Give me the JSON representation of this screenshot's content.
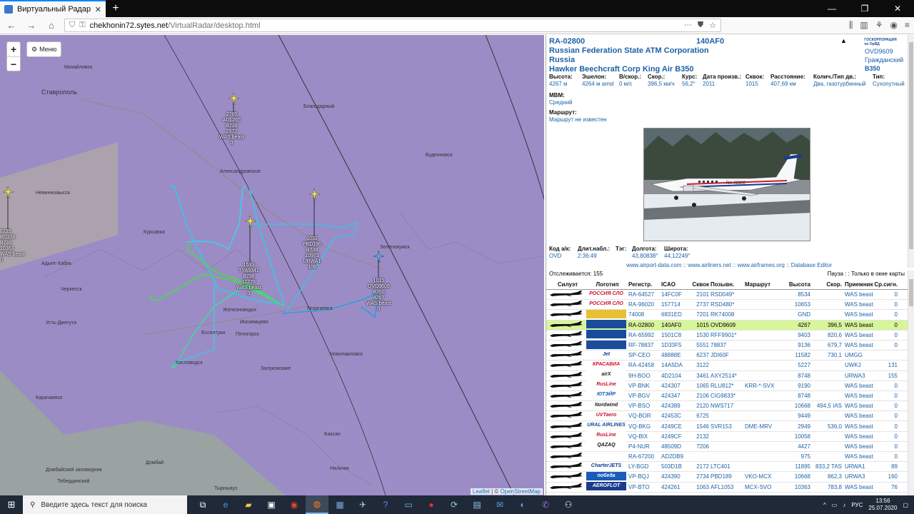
{
  "browser": {
    "tab_title": "Виртуальный Радар (155)",
    "tab_close": "✕",
    "new_tab": "+",
    "url_host": "chekhonin72.sytes.net",
    "url_path": "/VirtualRadar/desktop.html"
  },
  "map": {
    "zoom_in": "+",
    "zoom_out": "−",
    "menu_label": "Меню",
    "attribution_leaflet": "Leaflet",
    "attribution_sep": " | © ",
    "attribution_osm": "OpenStreetMap",
    "cities": [
      {
        "name": "Михайловск"
      },
      {
        "name": "Ставрополь"
      },
      {
        "name": "Благодарный"
      },
      {
        "name": "Буденновск"
      },
      {
        "name": "Александровское"
      },
      {
        "name": "Невинномысск"
      },
      {
        "name": "Курсавка"
      },
      {
        "name": "Зеленокумск"
      },
      {
        "name": "Адыге-Хабль"
      },
      {
        "name": "Черкесск"
      },
      {
        "name": "Усть-Джегута"
      },
      {
        "name": "Ессентуки"
      },
      {
        "name": "Пятигорск"
      },
      {
        "name": "Железноводск"
      },
      {
        "name": "Иноземцево"
      },
      {
        "name": "Георгиевск"
      },
      {
        "name": "Кисловодск"
      },
      {
        "name": "Новопавловск"
      },
      {
        "name": "Залукокоаже"
      },
      {
        "name": "Карачаевск"
      },
      {
        "name": "Домбай"
      },
      {
        "name": "Баксан"
      },
      {
        "name": "Нальчик"
      },
      {
        "name": "Тырныауз"
      },
      {
        "name": "Домбайский заповедник"
      },
      {
        "name": "Тебердинский"
      }
    ],
    "aircraft": [
      {
        "lines": [
          "2765",
          "AUL265",
          "B738",
          "2972",
          "WAS beast",
          "0"
        ]
      },
      {
        "lines": [
          "6735",
          "BD338",
          "B738",
          "10363",
          "WAS beast",
          "0"
        ]
      },
      {
        "lines": [
          "1032",
          "PBD196",
          "B738",
          "10973",
          "URWA1",
          "106"
        ]
      },
      {
        "lines": [
          "1533",
          "TYA9341",
          "B738",
          "11278",
          "WAS beast",
          "0"
        ]
      },
      {
        "lines": [
          "1015",
          "OVD9609",
          "B350",
          "4267",
          "WAS beast",
          "0"
        ]
      }
    ]
  },
  "detail": {
    "registration": "RA-02800",
    "icao": "140AF0",
    "operator": "Russian Federation State ATM Corporation",
    "country": "Russia",
    "model": "Hawker Beechcraft Corp King Air B350",
    "callsign": "OVD9609",
    "type_civil": "Гражданский",
    "type_code": "B350",
    "logo_text": "ГОСКОРПОРАЦИЯ по ОрВД",
    "stats": [
      {
        "label": "Высота:",
        "value": "4267 м"
      },
      {
        "label": "Эшелон:",
        "value": "4264 м amsl"
      },
      {
        "label": "В/скор.:",
        "value": "0 м/с"
      },
      {
        "label": "Скор.:",
        "value": "396,5 км/ч"
      },
      {
        "label": "Курс:",
        "value": "56,2°"
      },
      {
        "label": "Дата произв.:",
        "value": "2011"
      },
      {
        "label": "Сквок:",
        "value": "1015"
      },
      {
        "label": "Расстояние:",
        "value": "407,69 км"
      },
      {
        "label": "Колич./Тип дв.:",
        "value": "Два, газотурбинный"
      },
      {
        "label": "Тип:",
        "value": "Сухопутный"
      }
    ],
    "mvm_label": "MBM:",
    "mvm_value": "Средний",
    "route_label": "Маршрут:",
    "route_value": "Маршрут не известен",
    "photo_reg": "RA-02800",
    "bottom_stats": [
      {
        "label": "Код а/к:",
        "value": "OVD"
      },
      {
        "label": "Длит.набл.:",
        "value": "2:36:49"
      },
      {
        "label": "Тэг:",
        "value": ""
      },
      {
        "label": "Долгота:",
        "value": "43,80838°"
      },
      {
        "label": "Широта:",
        "value": "44,12249°"
      }
    ],
    "links": "www.airport-data.com :: www.airliners.net :: www.airframes.org :: Database Editor"
  },
  "list": {
    "tracked": "Отслеживается: 155",
    "status": "Пауза : : Только в окне карты",
    "headers": {
      "silhouette": "Силуэт",
      "logo": "Логотип",
      "reg": "Регистр.",
      "icao": "ICAO",
      "squawk": "Сквок",
      "callsign": "Позывн.",
      "route": "Маршрут",
      "altitude": "Высота",
      "speed": "Скор.",
      "receiver": "Приемник",
      "signal": "Ср.сигн."
    },
    "rows": [
      {
        "logo": "РОССИЯ СЛО",
        "logo_color": "#c8102e",
        "reg": "RA-64527",
        "icao": "14FC0F",
        "squawk": "2101",
        "callsign": "RSD049*",
        "route": "",
        "alt": "8534",
        "spd": "",
        "recv": "WAS beast",
        "sig": "0",
        "sel": false
      },
      {
        "logo": "РОССИЯ СЛО",
        "logo_color": "#c8102e",
        "reg": "RA-96020",
        "icao": "157714",
        "squawk": "2737",
        "callsign": "RSD480*",
        "route": "",
        "alt": "10653",
        "spd": "",
        "recv": "WAS beast",
        "sig": "0",
        "sel": false
      },
      {
        "logo": "",
        "logo_color": "#e8c030",
        "reg": "74008",
        "icao": "6831ED",
        "squawk": "7201",
        "callsign": "RK74008",
        "route": "",
        "alt": "GND",
        "spd": "",
        "recv": "WAS beast",
        "sig": "0",
        "sel": false
      },
      {
        "logo": "",
        "logo_color": "#1a4c9c",
        "reg": "RA-02800",
        "icao": "140AF0",
        "squawk": "1015",
        "callsign": "OVD9609",
        "route": "",
        "alt": "4267",
        "spd": "396,5",
        "recv": "WAS beast",
        "sig": "0",
        "sel": true
      },
      {
        "logo": "",
        "logo_color": "#1a4c9c",
        "reg": "RA-65992",
        "icao": "1501C8",
        "squawk": "1530",
        "callsign": "RFF9901*",
        "route": "",
        "alt": "9403",
        "spd": "820,6",
        "recv": "WAS beast",
        "sig": "0",
        "sel": false
      },
      {
        "logo": "",
        "logo_color": "#1a4c9c",
        "reg": "RF-78837",
        "icao": "1D33F5",
        "squawk": "5551",
        "callsign": "78837",
        "route": "",
        "alt": "9136",
        "spd": "679,7",
        "recv": "WAS beast",
        "sig": "0",
        "sel": false
      },
      {
        "logo": "Jet",
        "logo_color": "#0a3c8c",
        "reg": "SP-CEO",
        "icao": "48888E",
        "squawk": "6237",
        "callsign": "JDI60F",
        "route": "",
        "alt": "11582",
        "spd": "730,1",
        "recv": "UMGG",
        "sig": "",
        "sel": false
      },
      {
        "logo": "КРАСАВИА",
        "logo_color": "#d4102a",
        "reg": "RA-42458",
        "icao": "14A5DA",
        "squawk": "3122",
        "callsign": "",
        "route": "",
        "alt": "5227",
        "spd": "",
        "recv": "UWKJ",
        "sig": "131",
        "sel": false
      },
      {
        "logo": "airX",
        "logo_color": "#222",
        "reg": "9H-BOO",
        "icao": "4D2104",
        "squawk": "3461",
        "callsign": "AXY2514*",
        "route": "",
        "alt": "8748",
        "spd": "",
        "recv": "URWA3",
        "sig": "155",
        "sel": false
      },
      {
        "logo": "RusLine",
        "logo_color": "#d4102a",
        "reg": "VP-BNK",
        "icao": "424307",
        "squawk": "1065",
        "callsign": "RLU812*",
        "route": "KRR-*-SVX",
        "alt": "9190",
        "spd": "",
        "recv": "WAS beast",
        "sig": "0",
        "sel": false
      },
      {
        "logo": "ЮТЭЙР",
        "logo_color": "#1a5cb8",
        "reg": "VP-BGV",
        "icao": "424347",
        "squawk": "2106",
        "callsign": "CIG9833*",
        "route": "",
        "alt": "8748",
        "spd": "",
        "recv": "WAS beast",
        "sig": "0",
        "sel": false
      },
      {
        "logo": "Nordwind",
        "logo_color": "#222",
        "reg": "VP-BSO",
        "icao": "424389",
        "squawk": "2120",
        "callsign": "NWS717",
        "route": "",
        "alt": "10668",
        "spd": "494,5 IAS",
        "recv": "WAS beast",
        "sig": "0",
        "sel": false
      },
      {
        "logo": "UVTaero",
        "logo_color": "#c8102e",
        "reg": "VQ-BOR",
        "icao": "42453C",
        "squawk": "6725",
        "callsign": "",
        "route": "",
        "alt": "9449",
        "spd": "",
        "recv": "WAS beast",
        "sig": "0",
        "sel": false
      },
      {
        "logo": "URAL AIRLINES",
        "logo_color": "#1a4c9c",
        "reg": "VQ-BKG",
        "icao": "4249CE",
        "squawk": "1546",
        "callsign": "SVR153",
        "route": "DME-MRV",
        "alt": "2949",
        "spd": "536,0",
        "recv": "WAS beast",
        "sig": "0",
        "sel": false
      },
      {
        "logo": "RusLine",
        "logo_color": "#d4102a",
        "reg": "VQ-BIX",
        "icao": "4249CF",
        "squawk": "2132",
        "callsign": "",
        "route": "",
        "alt": "10058",
        "spd": "",
        "recv": "WAS beast",
        "sig": "0",
        "sel": false
      },
      {
        "logo": "QAZAQ",
        "logo_color": "#111",
        "reg": "P4-NUR",
        "icao": "48509D",
        "squawk": "7206",
        "callsign": "",
        "route": "",
        "alt": "4427",
        "spd": "",
        "recv": "WAS beast",
        "sig": "0",
        "sel": false
      },
      {
        "logo": "",
        "logo_color": "#ffffff",
        "reg": "RA-67200",
        "icao": "AD2DB9",
        "squawk": "",
        "callsign": "",
        "route": "",
        "alt": "975",
        "spd": "",
        "recv": "WAS beast",
        "sig": "0",
        "sel": false
      },
      {
        "logo": "CharterJETS",
        "logo_color": "#0a3c8c",
        "reg": "LY-BGD",
        "icao": "503D1B",
        "squawk": "2172",
        "callsign": "LTC401",
        "route": "",
        "alt": "11895",
        "spd": "833,2 TAS",
        "recv": "URWA1",
        "sig": "89",
        "sel": false
      },
      {
        "logo": "победа",
        "logo_color": "#1a5cb8",
        "reg": "VP-BQJ",
        "icao": "424390",
        "squawk": "2734",
        "callsign": "PBD189",
        "route": "VKO-MCX",
        "alt": "10668",
        "spd": "862,3",
        "recv": "URWA3",
        "sig": "160",
        "sel": false
      },
      {
        "logo": "AEROFLOT",
        "logo_color": "#1a3c8c",
        "reg": "VP-BTO",
        "icao": "424261",
        "squawk": "1063",
        "callsign": "AFL1053",
        "route": "MCX-SVO",
        "alt": "10363",
        "spd": "783,8",
        "recv": "WAS beast",
        "sig": "76",
        "sel": false
      }
    ]
  },
  "taskbar": {
    "search_placeholder": "Введите здесь текст для поиска",
    "lang": "РУС",
    "time": "13:56",
    "date": "25.07.2020"
  }
}
